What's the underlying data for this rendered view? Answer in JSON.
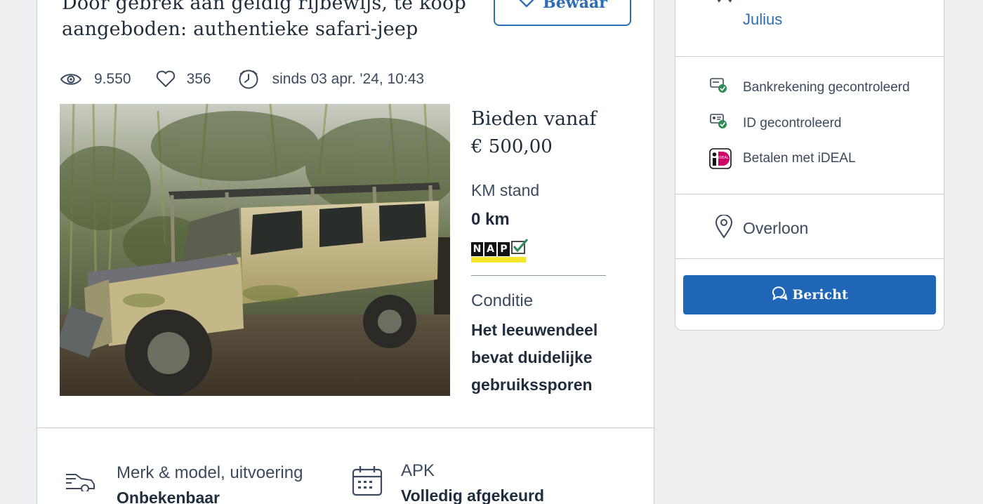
{
  "listing": {
    "title": "Door gebrek aan geldig rijbewijs, te koop aangeboden:  authentieke safari-jeep",
    "save_label": "Bewaar",
    "views": "9.550",
    "likes": "356",
    "since": "sinds 03 apr. '24, 10:43",
    "bid_label": "Bieden vanaf",
    "bid_price": "€ 500,00",
    "km_label": "KM stand",
    "km_value": "0 km",
    "nap_letters": [
      "N",
      "A",
      "P"
    ],
    "condition_label": "Conditie",
    "condition_value": "Het leeuwendeel bevat duidelijke gebruikssporen"
  },
  "specs": {
    "make_label": "Merk & model, uitvoering",
    "make_value": "Onbekenbaar",
    "apk_label": "APK",
    "apk_value": "Volledig afgekeurd"
  },
  "seller": {
    "name": "Julius",
    "bank": "Bankrekening gecontroleerd",
    "id": "ID gecontroleerd",
    "ideal": "Betalen met iDEAL",
    "ideal_badge": "iDEAL",
    "location": "Overloon",
    "message_label": "Bericht"
  },
  "colors": {
    "accent": "#1f66b6",
    "outline": "#2d6db5",
    "check_green": "#2e8b57",
    "ideal_pink": "#cc0066"
  },
  "icons": [
    "heart-icon",
    "eye-icon",
    "clock-icon",
    "bank-check-icon",
    "id-check-icon",
    "ideal-icon",
    "location-pin-icon",
    "chat-icon",
    "car-icon",
    "calendar-icon"
  ]
}
